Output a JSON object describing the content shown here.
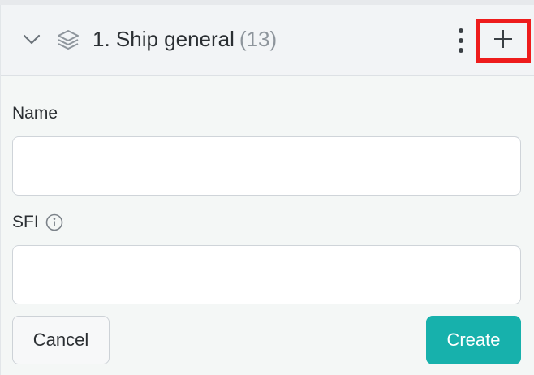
{
  "header": {
    "title": "1. Ship general",
    "count": "(13)",
    "icons": [
      "chevron-down-icon",
      "layers-icon",
      "more-vertical-icon",
      "plus-icon"
    ],
    "highlight_color": "#ee1c1c"
  },
  "form": {
    "name_label": "Name",
    "name_value": "",
    "sfi_label": "SFI",
    "sfi_value": "",
    "cancel_label": "Cancel",
    "create_label": "Create"
  },
  "colors": {
    "accent": "#17b1ac"
  }
}
